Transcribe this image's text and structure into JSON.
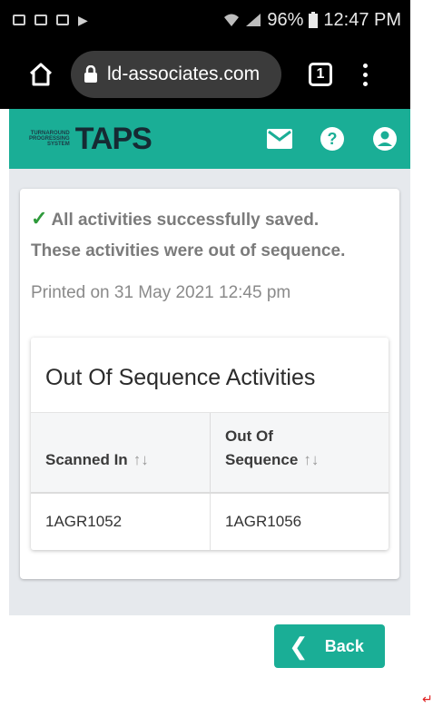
{
  "status_bar": {
    "battery": "96%",
    "time": "12:47 PM"
  },
  "browser": {
    "url": "ld-associates.com",
    "tab_count": "1"
  },
  "header": {
    "logo_text": "TAPS",
    "logo_subtext": [
      "TURNAROUND",
      "PROGRESSING",
      "SYSTEM"
    ]
  },
  "message": {
    "success_line1": "All activities successfully saved.",
    "success_line2": "These activities were out of sequence.",
    "printed": "Printed on 31 May 2021 12:45 pm"
  },
  "table": {
    "title": "Out Of Sequence Activities",
    "columns": [
      "Scanned In",
      "Out Of Sequence"
    ],
    "column2_line1": "Out Of",
    "column2_line2": "Sequence",
    "sort_glyph": "↑↓",
    "rows": [
      [
        "1AGR1052",
        "1AGR1056"
      ]
    ]
  },
  "actions": {
    "back_label": "Back"
  },
  "colors": {
    "accent": "#1aae96",
    "check": "#2e9a3b"
  }
}
